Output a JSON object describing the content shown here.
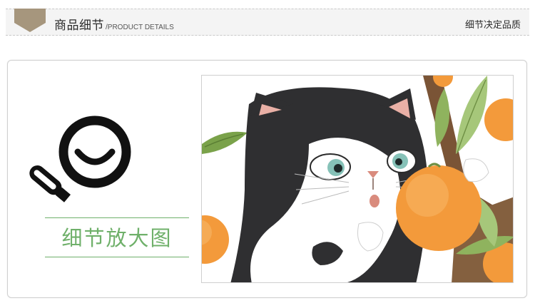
{
  "header": {
    "title_cn": "商品细节",
    "title_en": "/PRODUCT DETAILS",
    "right_text": "细节决定品质",
    "tab_color": "#a6967d"
  },
  "panel": {
    "zoom_label": "细节放大图",
    "label_color": "#6fb06a",
    "icon": "magnifier-icon",
    "image": "cat-with-oranges-illustration"
  }
}
